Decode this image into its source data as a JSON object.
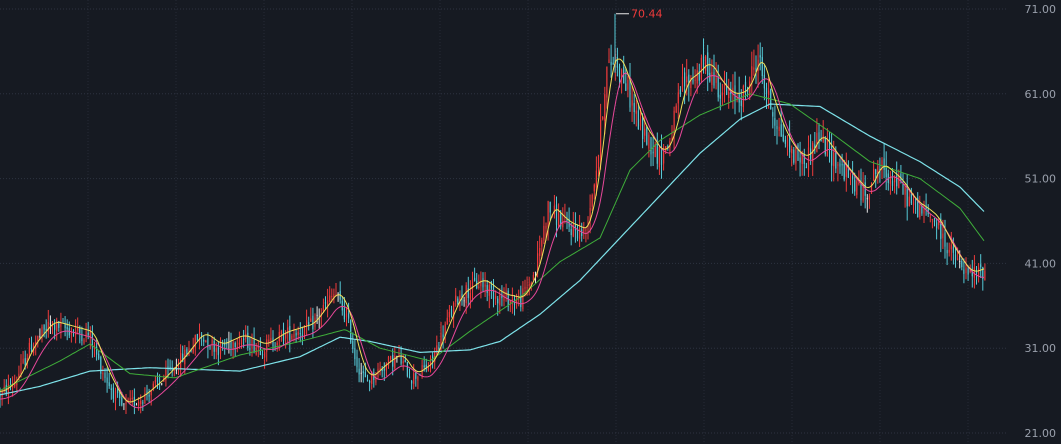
{
  "chart_data": {
    "type": "candlestick",
    "y_ticks": [
      "71.00",
      "61.00",
      "51.00",
      "41.00",
      "31.00",
      "21.00"
    ],
    "y_tick_values": [
      71,
      61,
      51,
      41,
      31,
      21
    ],
    "ylim": [
      21,
      71
    ],
    "grid": true,
    "peak_annotation": {
      "label": "70.44",
      "value": 70.44
    },
    "colors": {
      "background": "#161a22",
      "up": "#ee3b3b",
      "down": "#56c9d6",
      "flat": "#e8e8e8",
      "ma5": "#f2e25a",
      "ma10": "#e8489a",
      "ma20": "#3fae3a",
      "ma60": "#7ee3ea",
      "label": "#9aa0ac"
    },
    "price_path": [
      [
        0,
        25.5
      ],
      [
        15,
        27.0
      ],
      [
        30,
        31.0
      ],
      [
        50,
        33.8
      ],
      [
        75,
        33.0
      ],
      [
        90,
        32.5
      ],
      [
        100,
        29.0
      ],
      [
        110,
        26.5
      ],
      [
        122,
        24.0
      ],
      [
        140,
        25.0
      ],
      [
        160,
        27.0
      ],
      [
        180,
        29.5
      ],
      [
        200,
        32.5
      ],
      [
        218,
        31.0
      ],
      [
        240,
        32.2
      ],
      [
        262,
        31.0
      ],
      [
        282,
        32.5
      ],
      [
        310,
        33.5
      ],
      [
        335,
        37.5
      ],
      [
        347,
        34.5
      ],
      [
        356,
        29.5
      ],
      [
        366,
        27.0
      ],
      [
        385,
        29.0
      ],
      [
        398,
        30.0
      ],
      [
        412,
        27.5
      ],
      [
        430,
        29.0
      ],
      [
        445,
        33.5
      ],
      [
        458,
        37.0
      ],
      [
        480,
        38.8
      ],
      [
        500,
        37.0
      ],
      [
        520,
        36.5
      ],
      [
        535,
        40.0
      ],
      [
        548,
        47.5
      ],
      [
        565,
        45.5
      ],
      [
        585,
        44.5
      ],
      [
        598,
        53.5
      ],
      [
        606,
        63.5
      ],
      [
        615,
        65.5
      ],
      [
        626,
        62.0
      ],
      [
        640,
        57.0
      ],
      [
        660,
        53.5
      ],
      [
        670,
        55.5
      ],
      [
        682,
        62.0
      ],
      [
        694,
        63.0
      ],
      [
        706,
        64.5
      ],
      [
        718,
        62.0
      ],
      [
        730,
        60.5
      ],
      [
        745,
        61.0
      ],
      [
        758,
        65.5
      ],
      [
        768,
        60.5
      ],
      [
        780,
        56.5
      ],
      [
        792,
        54.0
      ],
      [
        805,
        53.0
      ],
      [
        818,
        56.0
      ],
      [
        830,
        54.0
      ],
      [
        850,
        51.0
      ],
      [
        865,
        49.0
      ],
      [
        878,
        52.5
      ],
      [
        898,
        50.5
      ],
      [
        912,
        48.0
      ],
      [
        925,
        47.0
      ],
      [
        935,
        46.0
      ],
      [
        945,
        43.5
      ],
      [
        958,
        41.0
      ],
      [
        968,
        39.5
      ],
      [
        985,
        40.2
      ]
    ],
    "ma_offsets": {
      "ma5": 0.4,
      "ma10": -0.5
    },
    "ma20_path": [
      [
        0,
        26.0
      ],
      [
        60,
        29.5
      ],
      [
        90,
        31.5
      ],
      [
        130,
        28.0
      ],
      [
        175,
        27.5
      ],
      [
        240,
        30.2
      ],
      [
        300,
        31.8
      ],
      [
        345,
        33.2
      ],
      [
        380,
        31.0
      ],
      [
        430,
        29.5
      ],
      [
        470,
        33.0
      ],
      [
        520,
        37.0
      ],
      [
        560,
        41.2
      ],
      [
        600,
        44.0
      ],
      [
        630,
        52.0
      ],
      [
        660,
        55.5
      ],
      [
        700,
        58.5
      ],
      [
        750,
        61.0
      ],
      [
        790,
        59.8
      ],
      [
        830,
        56.5
      ],
      [
        870,
        53.0
      ],
      [
        920,
        51.0
      ],
      [
        960,
        47.5
      ],
      [
        985,
        43.5
      ]
    ],
    "ma60_path": [
      [
        0,
        25.5
      ],
      [
        40,
        26.5
      ],
      [
        90,
        28.3
      ],
      [
        150,
        28.7
      ],
      [
        240,
        28.3
      ],
      [
        300,
        30.0
      ],
      [
        340,
        32.3
      ],
      [
        370,
        31.8
      ],
      [
        420,
        30.5
      ],
      [
        470,
        30.8
      ],
      [
        500,
        31.8
      ],
      [
        540,
        35.0
      ],
      [
        580,
        39.0
      ],
      [
        620,
        44.0
      ],
      [
        660,
        49.0
      ],
      [
        700,
        54.0
      ],
      [
        740,
        58.0
      ],
      [
        770,
        59.8
      ],
      [
        820,
        59.5
      ],
      [
        870,
        56.0
      ],
      [
        920,
        53.0
      ],
      [
        960,
        50.0
      ],
      [
        985,
        47.0
      ]
    ]
  }
}
